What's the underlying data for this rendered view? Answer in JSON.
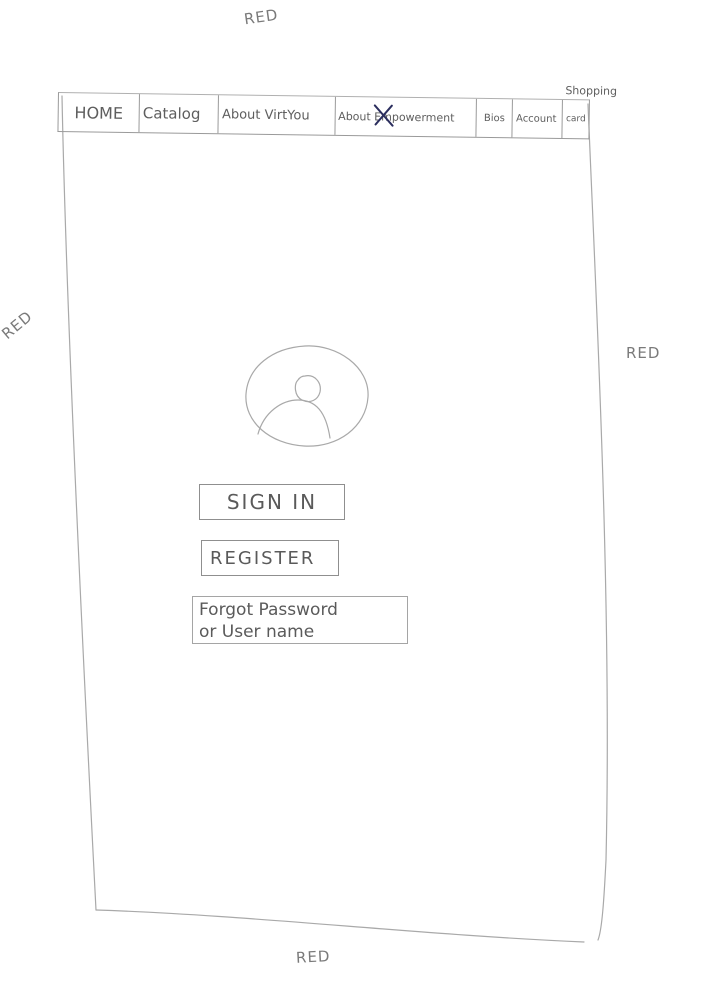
{
  "notes": {
    "top": "RED",
    "left": "RED",
    "right": "RED",
    "bottom": "RED"
  },
  "nav": {
    "home": "HOME",
    "catalog": "Catalog",
    "about_virtyou": "About VirtYou",
    "about_empowerment": "About Empowerment",
    "bios": "Bios",
    "account": "Account",
    "shopping_top": "Shopping",
    "shopping_bottom": "card"
  },
  "avatar": {
    "icon": "user-avatar-icon"
  },
  "auth": {
    "sign_in": "SIGN IN",
    "register": "REGISTER",
    "forgot_line1": "Forgot Password",
    "forgot_line2": "or User name"
  },
  "colors": {
    "pencil": "#8f8f8f",
    "strike": "#2b2e5e",
    "paper": "#ffffff"
  }
}
